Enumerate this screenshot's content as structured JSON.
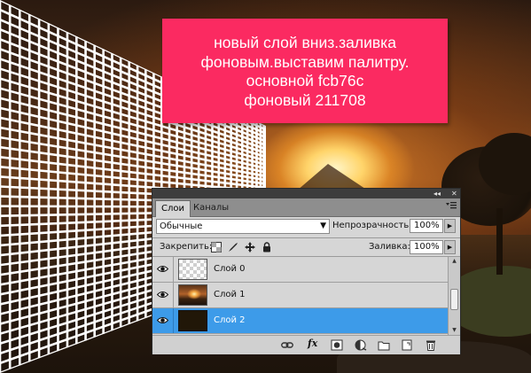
{
  "note": {
    "lines": [
      "новый слой вниз.заливка",
      "фоновым.выставим палитру.",
      "основной fcb76c",
      "фоновый 211708"
    ]
  },
  "panel": {
    "titlebar_controls": "◂◂  ✕",
    "tabs": [
      {
        "label": "Слои",
        "active": true
      },
      {
        "label": "Каналы",
        "active": false
      }
    ],
    "menu_icon": "panel-menu-icon",
    "blend_mode": "Обычные",
    "opacity_label": "Непрозрачность:",
    "opacity_value": "100%",
    "lock_label": "Закрепить:",
    "fill_label": "Заливка:",
    "fill_value": "100%",
    "layers": [
      {
        "name": "Слой 0",
        "thumbnail": "transparent",
        "visible": true,
        "selected": false
      },
      {
        "name": "Слой 1",
        "thumbnail": "photo",
        "visible": true,
        "selected": false
      },
      {
        "name": "Слой 2",
        "thumbnail": "solid",
        "visible": true,
        "selected": true
      }
    ],
    "bottom_icons": [
      "link-layers-icon",
      "fx-icon",
      "layer-mask-icon",
      "adjustment-layer-icon",
      "new-group-icon",
      "new-layer-icon",
      "trash-icon"
    ],
    "fx_label": "fx"
  },
  "colors": {
    "note_bg": "#fb2a61",
    "selected_row": "#3d9be9",
    "foreground": "#fcb76c",
    "background": "#211708"
  }
}
